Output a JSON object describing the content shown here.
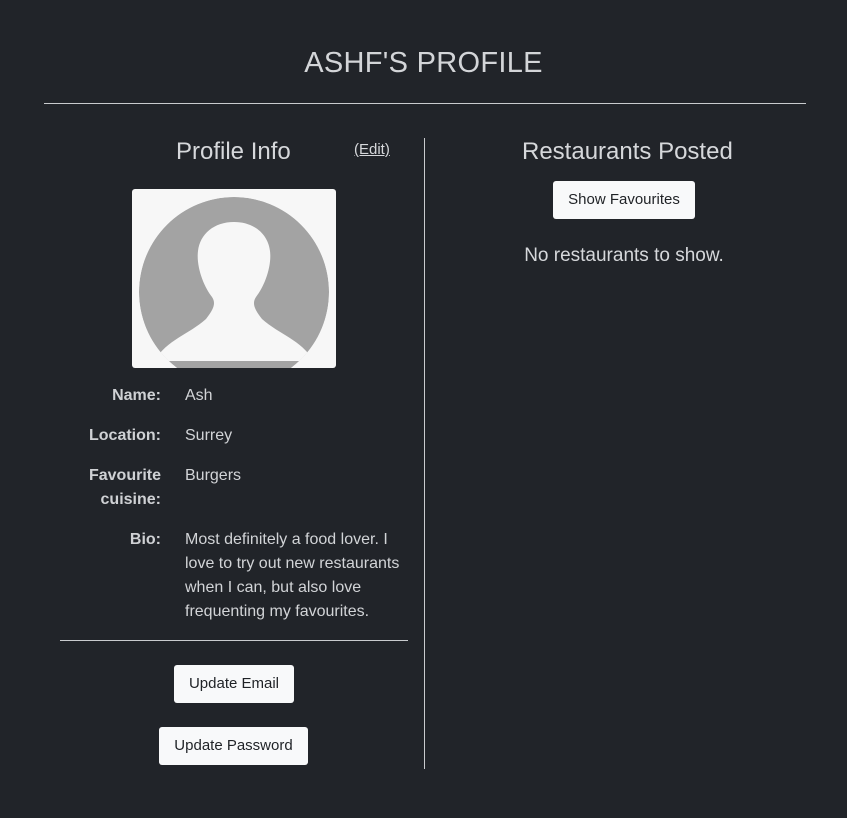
{
  "header": {
    "title": "ASHF'S PROFILE"
  },
  "profile_info": {
    "heading": "Profile Info",
    "edit_link": "(Edit)",
    "avatar": {
      "icon": "default-user-silhouette-icon"
    },
    "fields": {
      "name": {
        "label": "Name:",
        "value": "Ash"
      },
      "location": {
        "label": "Location:",
        "value": "Surrey"
      },
      "favourite_cuisine": {
        "label": "Favourite cuisine:",
        "value": "Burgers"
      },
      "bio": {
        "label": "Bio:",
        "value": "Most definitely a food lover. I love to try out new restaurants when I can, but also love frequenting my favourites."
      }
    },
    "buttons": {
      "update_email": "Update Email",
      "update_password": "Update Password"
    }
  },
  "restaurants": {
    "heading": "Restaurants Posted",
    "show_favourites": "Show Favourites",
    "empty_message": "No restaurants to show."
  },
  "colors": {
    "background": "#212429",
    "text": "#dfe1e4",
    "button_bg": "#f8f9fa",
    "button_text": "#1f2226",
    "avatar_bg": "#f7f7f7",
    "avatar_silhouette": "#a3a3a3"
  }
}
